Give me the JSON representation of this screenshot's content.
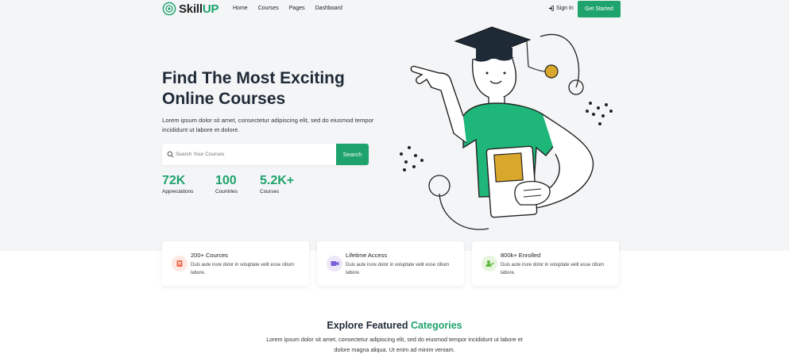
{
  "brand": {
    "name_main": "Skill",
    "name_accent": "UP",
    "accent_color": "#1fa36c"
  },
  "nav": {
    "items": [
      {
        "label": "Home"
      },
      {
        "label": "Courses"
      },
      {
        "label": "Pages"
      },
      {
        "label": "Dashboard"
      }
    ],
    "signin_label": "Sign In",
    "cta_label": "Get Started"
  },
  "hero": {
    "title_line1": "Find The Most Exciting",
    "title_line2": "Online Courses",
    "description": "Lorem ipsum dolor sit amet, consectetur adipiscing elit, sed do eiusmod tempor incididunt ut labore et dolore.",
    "search": {
      "placeholder": "Search Your Courses",
      "button_label": "Search"
    },
    "stats": [
      {
        "value": "72K",
        "label": "Appreciations"
      },
      {
        "value": "100",
        "label": "Countries"
      },
      {
        "value": "5.2K+",
        "label": "Courses"
      }
    ]
  },
  "features": [
    {
      "icon": "book-icon",
      "icon_color": "#f26b4f",
      "icon_bg": "#fde9e3",
      "title": "200+ Cources",
      "desc": "Duis aute irure dolor in voluptate velit esse cillum labore."
    },
    {
      "icon": "video-icon",
      "icon_color": "#7a5fd6",
      "icon_bg": "#ece8fa",
      "title": "Lifetime Access",
      "desc": "Duis aute irure dolor in voluptate velit esse cillum labore."
    },
    {
      "icon": "user-check-icon",
      "icon_color": "#5fb63a",
      "icon_bg": "#e7f5df",
      "title": "800k+ Enrolled",
      "desc": "Duis aute irure dolor in voluptate velit esse cillum labore."
    }
  ],
  "explore": {
    "title_main": "Explore Featured",
    "title_accent": "Categories",
    "description": "Lorem ipsum dolor sit amet, consectetur adipiscing elit, sed do eiusmod tempor incididunt ut labore et dolore magna aliqua. Ut enim ad minim veniam."
  }
}
